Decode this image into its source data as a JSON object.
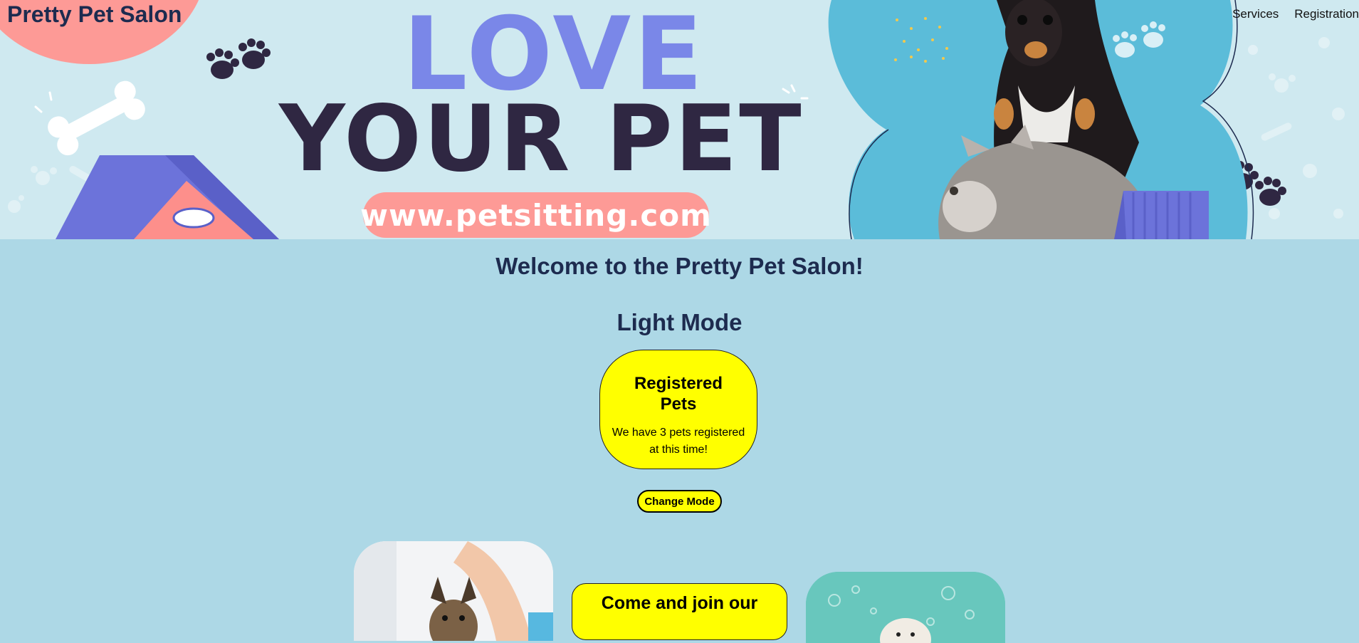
{
  "header": {
    "salon_name": "Pretty Pet Salon",
    "nav": [
      {
        "label": "Services"
      },
      {
        "label": "Registration"
      }
    ]
  },
  "hero": {
    "line1": "LOVE",
    "line2": "YOUR PET",
    "url": "www.petsitting.com"
  },
  "main": {
    "welcome": "Welcome to the Pretty Pet Salon!",
    "mode_title": "Light Mode",
    "registered_card": {
      "title": "Registered Pets",
      "text": "We have 3 pets registered at this time!"
    },
    "change_mode_label": "Change Mode",
    "join_card": {
      "title": "Come and join our"
    }
  },
  "colors": {
    "page_bg": "#add8e6",
    "hero_bg": "#cfe9f0",
    "accent_pink": "#fd9a96",
    "accent_blue": "#7a87e8",
    "dark_text": "#2f2742",
    "card_yellow": "#ffff00",
    "heading_navy": "#1d2b4f"
  },
  "icons": [
    "paw-print-icon",
    "bone-icon",
    "dog-house-icon",
    "dog-photo",
    "cat-photo",
    "groomed-dog-photo",
    "bath-dog-photo"
  ]
}
